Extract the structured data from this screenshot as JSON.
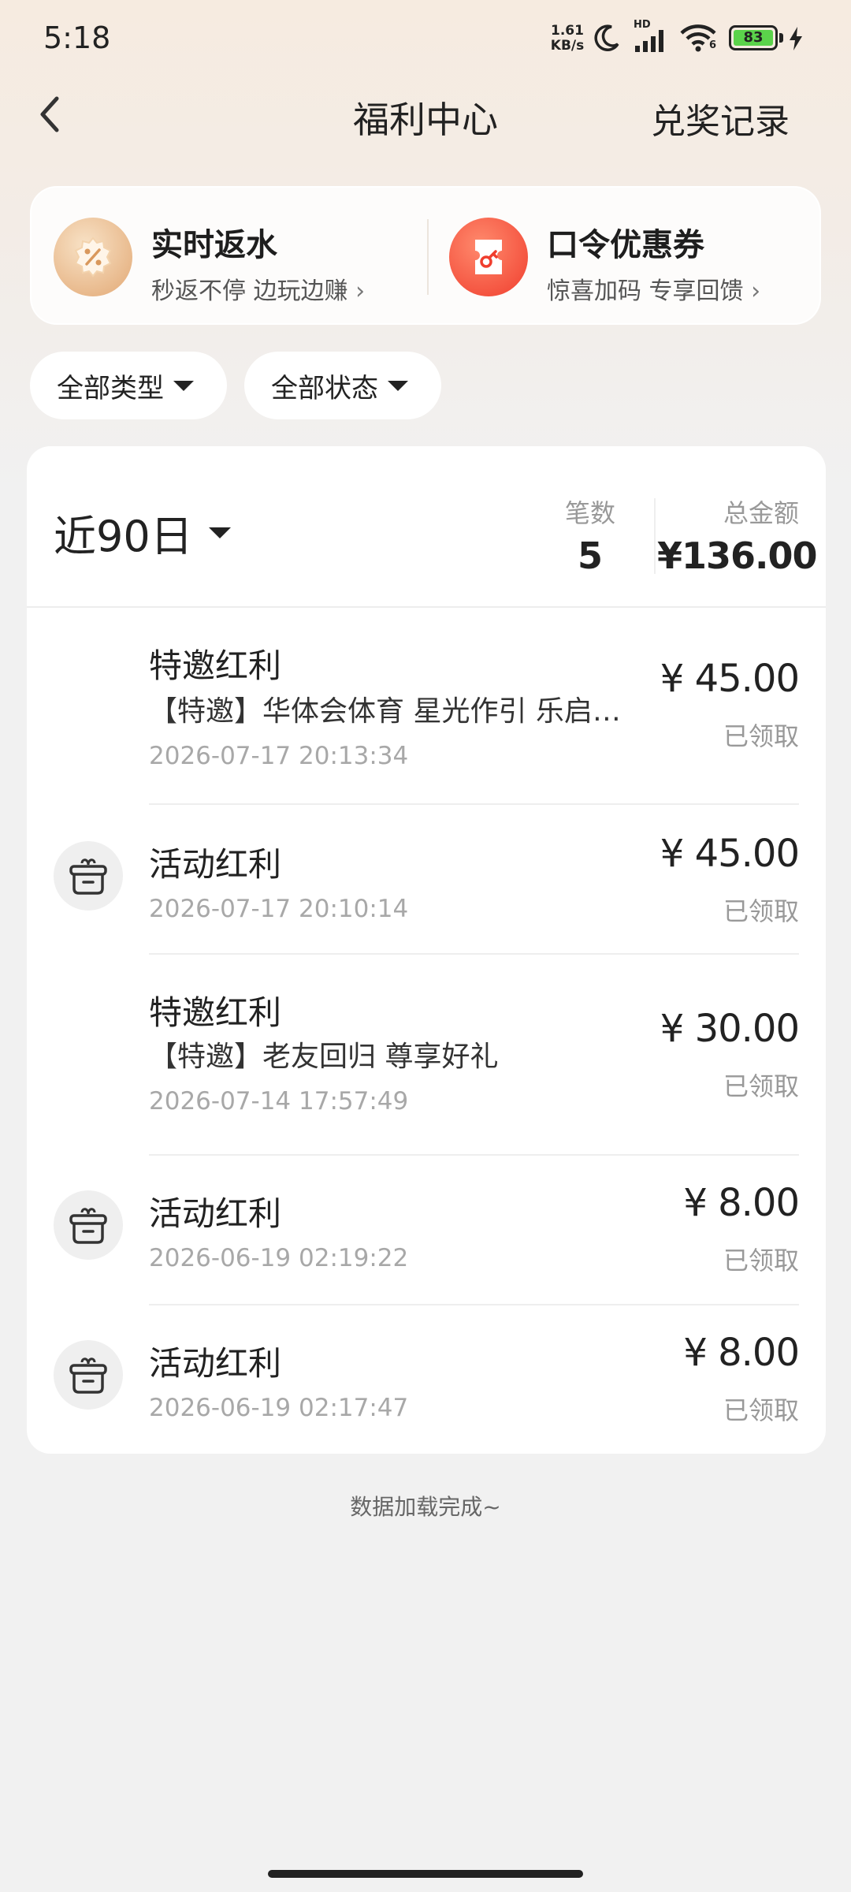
{
  "status_bar": {
    "time": "5:18",
    "net_speed_value": "1.61",
    "net_speed_unit": "KB/s",
    "hd_label": "HD",
    "wifi_badge": "6",
    "battery_level": "83",
    "icons": [
      "moon-icon",
      "signal-icon",
      "wifi-icon",
      "battery-icon",
      "charging-icon"
    ]
  },
  "header": {
    "title": "福利中心",
    "right_link": "兑奖记录",
    "back_icon": "chevron-left-icon"
  },
  "promos": [
    {
      "title": "实时返水",
      "subtitle": "秒返不停 边玩边赚",
      "icon": "percent-badge-icon",
      "color": "#e2a874"
    },
    {
      "title": "口令优惠券",
      "subtitle": "惊喜加码 专享回馈",
      "icon": "key-ticket-icon",
      "color": "#f03e2e"
    }
  ],
  "filters": {
    "type_label": "全部类型",
    "status_label": "全部状态"
  },
  "summary": {
    "range_label": "近90日",
    "count_label": "笔数",
    "count_value": "5",
    "total_label": "总金额",
    "total_value": "¥136.00"
  },
  "records": [
    {
      "title": "特邀红利",
      "desc": "【特邀】华体会体育 星光作引 乐启…",
      "time": "2026-07-17 20:13:34",
      "amount": "¥ 45.00",
      "status": "已领取",
      "has_icon": false
    },
    {
      "title": "活动红利",
      "desc": "",
      "time": "2026-07-17 20:10:14",
      "amount": "¥ 45.00",
      "status": "已领取",
      "has_icon": true
    },
    {
      "title": "特邀红利",
      "desc": "【特邀】老友回归 尊享好礼",
      "time": "2026-07-14 17:57:49",
      "amount": "¥ 30.00",
      "status": "已领取",
      "has_icon": false
    },
    {
      "title": "活动红利",
      "desc": "",
      "time": "2026-06-19 02:19:22",
      "amount": "¥ 8.00",
      "status": "已领取",
      "has_icon": true
    },
    {
      "title": "活动红利",
      "desc": "",
      "time": "2026-06-19 02:17:47",
      "amount": "¥ 8.00",
      "status": "已领取",
      "has_icon": true
    }
  ],
  "footer": {
    "note": "数据加载完成~"
  }
}
